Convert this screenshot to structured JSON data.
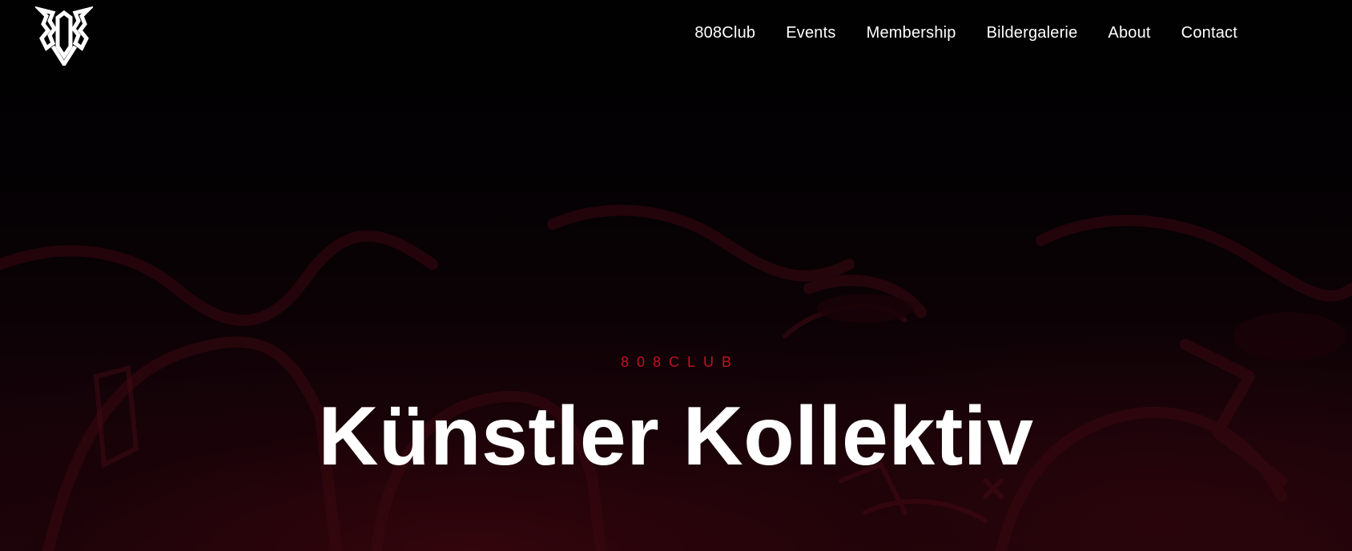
{
  "header": {
    "logo_text": "808",
    "nav": [
      {
        "label": "808Club"
      },
      {
        "label": "Events"
      },
      {
        "label": "Membership"
      },
      {
        "label": "Bildergalerie"
      },
      {
        "label": "About"
      },
      {
        "label": "Contact"
      }
    ]
  },
  "hero": {
    "eyebrow": "808CLUB",
    "title": "Künstler Kollektiv"
  },
  "colors": {
    "background": "#000000",
    "accent": "#c0121f",
    "text": "#ffffff"
  }
}
